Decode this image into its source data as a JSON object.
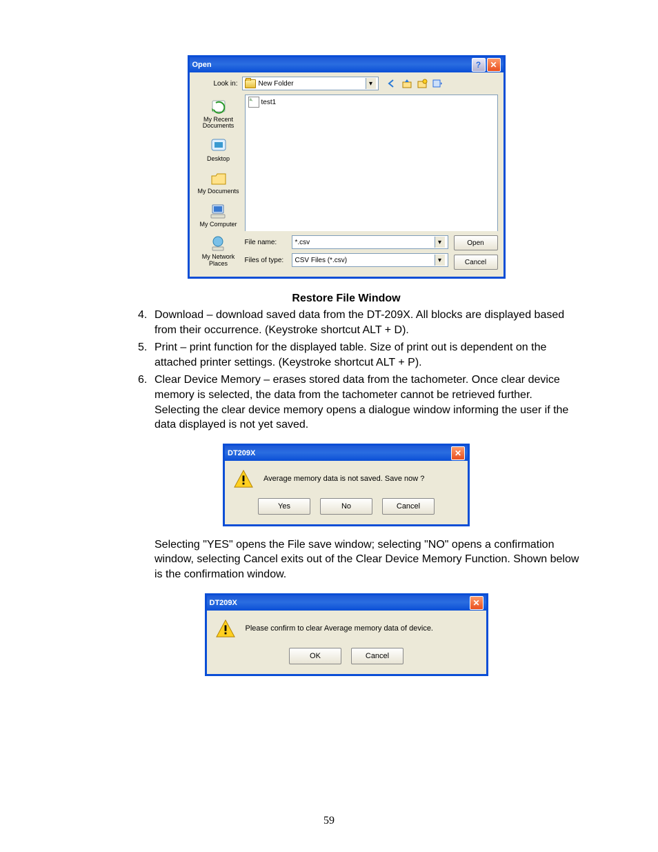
{
  "openDialog": {
    "title": "Open",
    "lookInLabel": "Look in:",
    "lookInValue": "New Folder",
    "places": [
      {
        "id": "recent",
        "label": "My Recent\nDocuments"
      },
      {
        "id": "desktop",
        "label": "Desktop"
      },
      {
        "id": "mydocs",
        "label": "My Documents"
      },
      {
        "id": "mycomp",
        "label": "My Computer"
      },
      {
        "id": "network",
        "label": "My Network\nPlaces"
      }
    ],
    "fileItem": "test1",
    "fileNameLabel": "File name:",
    "fileNameValue": "*.csv",
    "fileTypeLabel": "Files of type:",
    "fileTypeValue": "CSV Files (*.csv)",
    "openBtn": "Open",
    "cancelBtn": "Cancel"
  },
  "caption1": "Restore File Window",
  "list": {
    "item4": "Download – download saved data from the DT-209X. All blocks are displayed based from their occurrence.  (Keystroke shortcut ALT + D).",
    "item5": "Print – print function for the displayed table.  Size of print out is dependent on the attached printer settings. (Keystroke shortcut ALT + P).",
    "item6a": "Clear Device Memory – erases stored data from the tachometer. Once clear device memory is selected, the data from the tachometer cannot be retrieved further.",
    "item6b": "Selecting the clear device memory opens a dialogue window informing the user if the data displayed is not yet saved."
  },
  "msg1": {
    "title": "DT209X",
    "text": "Average memory data is not saved. Save now ?",
    "yes": "Yes",
    "no": "No",
    "cancel": "Cancel"
  },
  "para2": "Selecting \"YES\" opens the File save window; selecting \"NO\" opens a confirmation window, selecting Cancel exits out of the Clear Device Memory Function.  Shown below is the confirmation window.",
  "msg2": {
    "title": "DT209X",
    "text": "Please confirm to clear Average memory data of device.",
    "ok": "OK",
    "cancel": "Cancel"
  },
  "pageNumber": "59"
}
